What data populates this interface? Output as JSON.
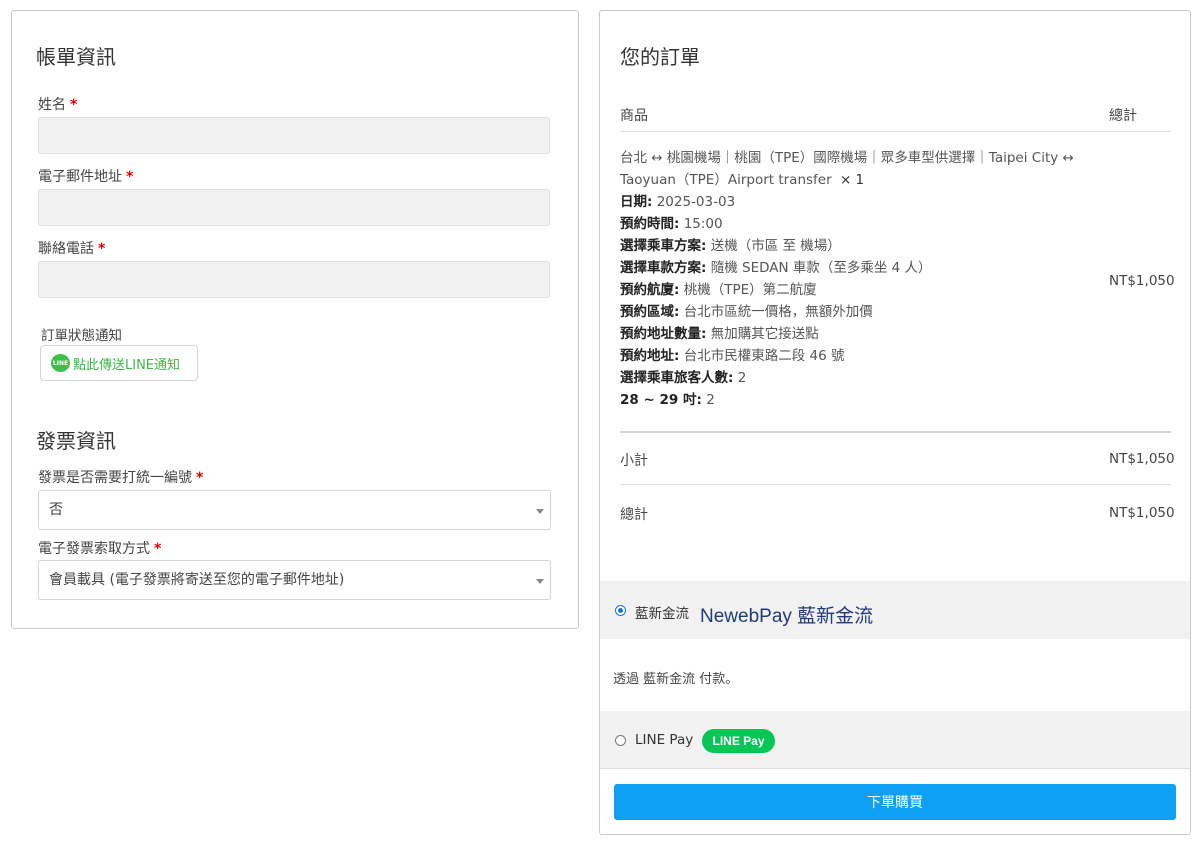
{
  "billing": {
    "title": "帳單資訊",
    "name_label": "姓名",
    "email_label": "電子郵件地址",
    "phone_label": "聯絡電話",
    "required_mark": "*",
    "notify_label": "訂單狀態通知",
    "line_icon_text": "LINE",
    "line_button_label": "點此傳送LINE通知"
  },
  "invoice": {
    "title": "發票資訊",
    "tax_id_label": "發票是否需要打統一編號",
    "tax_id_value": "否",
    "method_label": "電子發票索取方式",
    "method_value": "會員載具 (電子發票將寄送至您的電子郵件地址)"
  },
  "order": {
    "title": "您的訂單",
    "col_product": "商品",
    "col_total": "總計",
    "product_name_line1": "台北 ↔ 桃園機場｜桃園（TPE）國際機場｜眾多車型供選擇｜Taipei City ↔",
    "product_name_line2": "Taoyuan（TPE）Airport transfer",
    "quantity": "× 1",
    "details": [
      {
        "key": "日期:",
        "value": "2025-03-03"
      },
      {
        "key": "預約時間:",
        "value": "15:00"
      },
      {
        "key": "選擇乘車方案:",
        "value": "送機（市區 至 機場）"
      },
      {
        "key": "選擇車款方案:",
        "value": "隨機 SEDAN 車款（至多乘坐 4 人）"
      },
      {
        "key": "預約航廈:",
        "value": "桃機（TPE）第二航廈"
      },
      {
        "key": "預約區域:",
        "value": "台北市區統一價格，無額外加價"
      },
      {
        "key": "預約地址數量:",
        "value": "無加購其它接送點"
      },
      {
        "key": "預約地址:",
        "value": "台北市民權東路二段 46 號"
      },
      {
        "key": "選擇乘車旅客人數:",
        "value": "2"
      },
      {
        "key": "28 ~ 29 吋:",
        "value": "2"
      }
    ],
    "line_total": "NT$1,050",
    "subtotal_label": "小計",
    "subtotal_value": "NT$1,050",
    "total_label": "總計",
    "total_value": "NT$1,050"
  },
  "payment": {
    "newebpay_label": "藍新金流",
    "newebpay_logo": "NewebPay 藍新金流",
    "newebpay_selected": true,
    "newebpay_desc": "透過 藍新金流 付款。",
    "linepay_label": "LINE Pay",
    "linepay_badge": "LINE Pay",
    "linepay_selected": false,
    "place_order": "下單購買"
  },
  "colors": {
    "accent": "#0fa0f5",
    "required": "#dd0000",
    "line_green": "#06c755",
    "newebpay_navy": "#1f3a7a"
  }
}
